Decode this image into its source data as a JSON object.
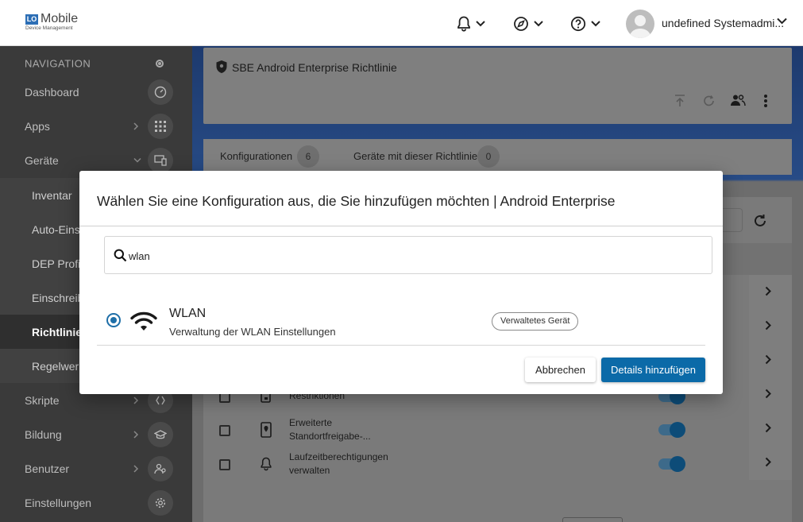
{
  "header": {
    "logo_badge": "LO",
    "logo_name": "Mobile",
    "logo_sub": "Device Management",
    "user_name": "undefined Systemadmi...",
    "icons": [
      "bell-icon",
      "compass-icon",
      "help-icon",
      "avatar-icon"
    ]
  },
  "sidebar": {
    "heading": "NAVIGATION",
    "items": [
      {
        "label": "Dashboard",
        "icon": "speedometer-icon"
      },
      {
        "label": "Apps",
        "icon": "grid-icon"
      },
      {
        "label": "Geräte",
        "icon": "devices-icon"
      },
      {
        "label": "Inventar"
      },
      {
        "label": "Auto-Einsc"
      },
      {
        "label": "DEP Profile"
      },
      {
        "label": "Einschreib"
      },
      {
        "label": "Richtlinien"
      },
      {
        "label": "Regelwerk"
      },
      {
        "label": "Skripte",
        "icon": "code-icon"
      },
      {
        "label": "Bildung",
        "icon": "graduation-icon"
      },
      {
        "label": "Benutzer",
        "icon": "users-icon"
      },
      {
        "label": "Einstellungen",
        "icon": "gear-icon"
      }
    ]
  },
  "policy": {
    "title": "SBE Android Enterprise Richtlinie",
    "tabs": [
      {
        "label": "Konfigurationen",
        "count": "6"
      },
      {
        "label": "Geräte mit dieser Richtlinie",
        "count": "0"
      }
    ],
    "rows": [
      {
        "label": "Restriktionen"
      },
      {
        "label": "Erweiterte Standortfreigabe-..."
      },
      {
        "label": "Laufzeitberechtigungen verwalten"
      }
    ]
  },
  "modal": {
    "title": "Wählen Sie eine Konfiguration aus, die Sie hinzufügen möchten | Android Enterprise",
    "search_value": "wlan",
    "option": {
      "title": "WLAN",
      "description": "Verwaltung der WLAN Einstellungen",
      "chip": "Verwaltetes Gerät",
      "icon": "wifi-icon"
    },
    "cancel_label": "Abbrechen",
    "add_label": "Details hinzufügen"
  },
  "colors": {
    "primary": "#0b6aa8",
    "sidebar_bg": "#3a3a3a"
  }
}
